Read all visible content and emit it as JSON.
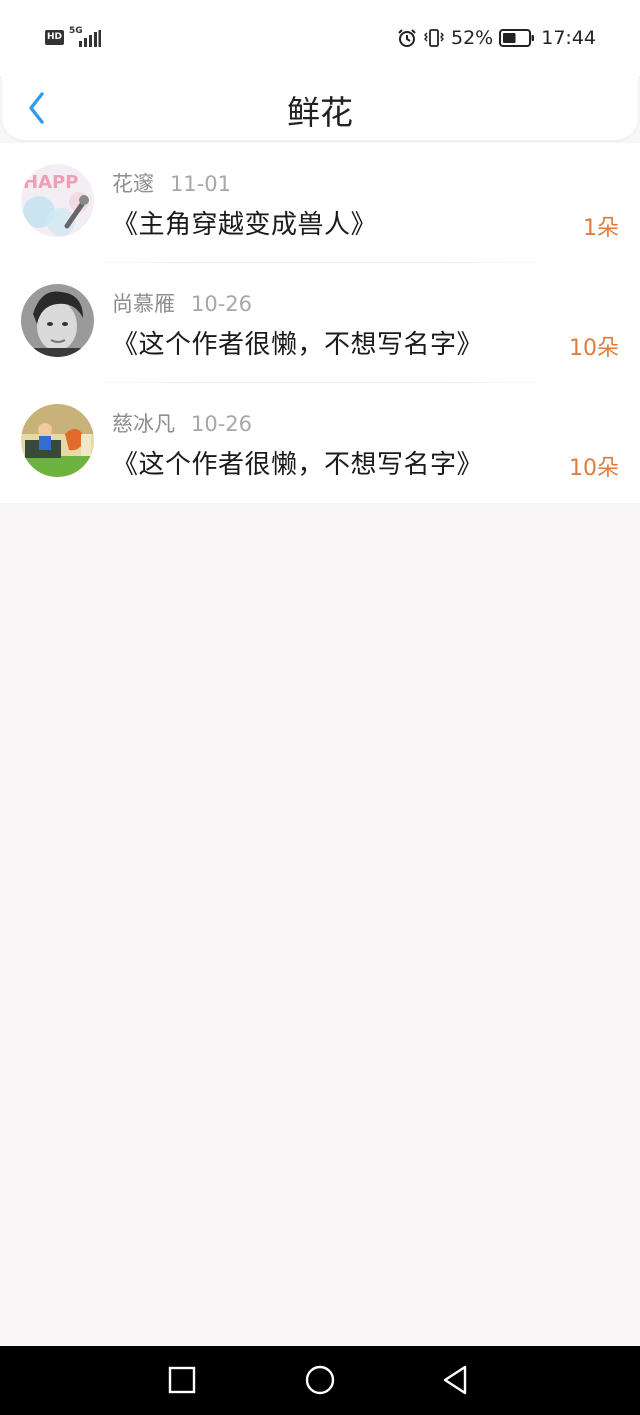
{
  "status_bar": {
    "hd": "HD",
    "network": "5G",
    "battery_percent": "52%",
    "battery_level": 0.52,
    "time": "17:44",
    "icons": [
      "alarm-icon",
      "vibrate-icon",
      "battery-icon"
    ]
  },
  "header": {
    "title": "鲜花",
    "back_icon": "chevron-left-icon"
  },
  "flowers": [
    {
      "name": "花邃",
      "date": "11-01",
      "book": "《主角穿越变成兽人》",
      "count": "1朵"
    },
    {
      "name": "尚慕雁",
      "date": "10-26",
      "book": "《这个作者很懒，不想写名字》",
      "count": "10朵"
    },
    {
      "name": "慈冰凡",
      "date": "10-26",
      "book": "《这个作者很懒，不想写名字》",
      "count": "10朵"
    }
  ],
  "nav_bar": {
    "items": [
      "recents-square-icon",
      "home-circle-icon",
      "back-triangle-icon"
    ]
  },
  "colors": {
    "accent": "#2e9bf0",
    "count": "#e07c38",
    "background": "#f8f6f7"
  }
}
